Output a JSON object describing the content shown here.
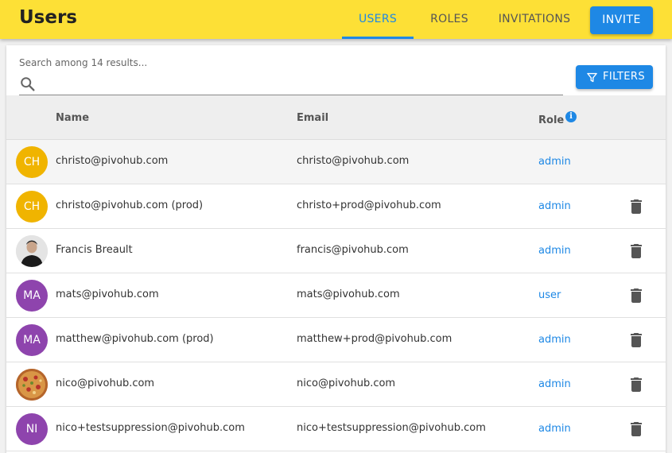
{
  "header": {
    "title": "Users",
    "tabs": [
      {
        "label": "USERS",
        "active": true
      },
      {
        "label": "ROLES",
        "active": false
      },
      {
        "label": "INVITATIONS",
        "active": false
      }
    ],
    "invite_label": "INVITE"
  },
  "search": {
    "label": "Search among 14 results...",
    "value": ""
  },
  "filters_label": "FILTERS",
  "table": {
    "columns": {
      "name": "Name",
      "email": "Email",
      "role": "Role"
    },
    "rows": [
      {
        "initials": "CH",
        "avatar_color": "#f0b400",
        "name": "christo@pivohub.com",
        "email": "christo@pivohub.com",
        "role": "admin",
        "deletable": false
      },
      {
        "initials": "CH",
        "avatar_color": "#f0b400",
        "name": "christo@pivohub.com (prod)",
        "email": "christo+prod@pivohub.com",
        "role": "admin",
        "deletable": true
      },
      {
        "initials": "",
        "avatar_type": "person-photo",
        "name": "Francis Breault",
        "email": "francis@pivohub.com",
        "role": "admin",
        "deletable": true
      },
      {
        "initials": "MA",
        "avatar_color": "#8e44ad",
        "name": "mats@pivohub.com",
        "email": "mats@pivohub.com",
        "role": "user",
        "deletable": true
      },
      {
        "initials": "MA",
        "avatar_color": "#8e44ad",
        "name": "matthew@pivohub.com (prod)",
        "email": "matthew+prod@pivohub.com",
        "role": "admin",
        "deletable": true
      },
      {
        "initials": "",
        "avatar_type": "food-photo",
        "name": "nico@pivohub.com",
        "email": "nico@pivohub.com",
        "role": "admin",
        "deletable": true
      },
      {
        "initials": "NI",
        "avatar_color": "#8e44ad",
        "name": "nico+testsuppression@pivohub.com",
        "email": "nico+testsuppression@pivohub.com",
        "role": "admin",
        "deletable": true
      }
    ]
  },
  "colors": {
    "accent": "#1e88e5",
    "header_bg": "#fde036"
  }
}
